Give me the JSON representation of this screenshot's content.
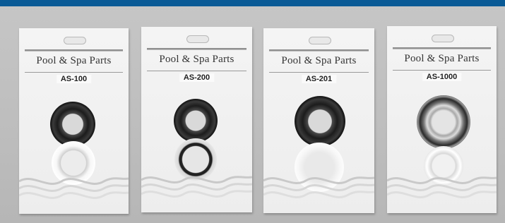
{
  "cards": [
    {
      "brand": "Pool & Spa Parts",
      "code": "AS-100"
    },
    {
      "brand": "Pool & Spa Parts",
      "code": "AS-200"
    },
    {
      "brand": "Pool & Spa Parts",
      "code": "AS-201"
    },
    {
      "brand": "Pool & Spa Parts",
      "code": "AS-1000"
    }
  ],
  "colors": {
    "top_bar": "#0a5a96"
  }
}
